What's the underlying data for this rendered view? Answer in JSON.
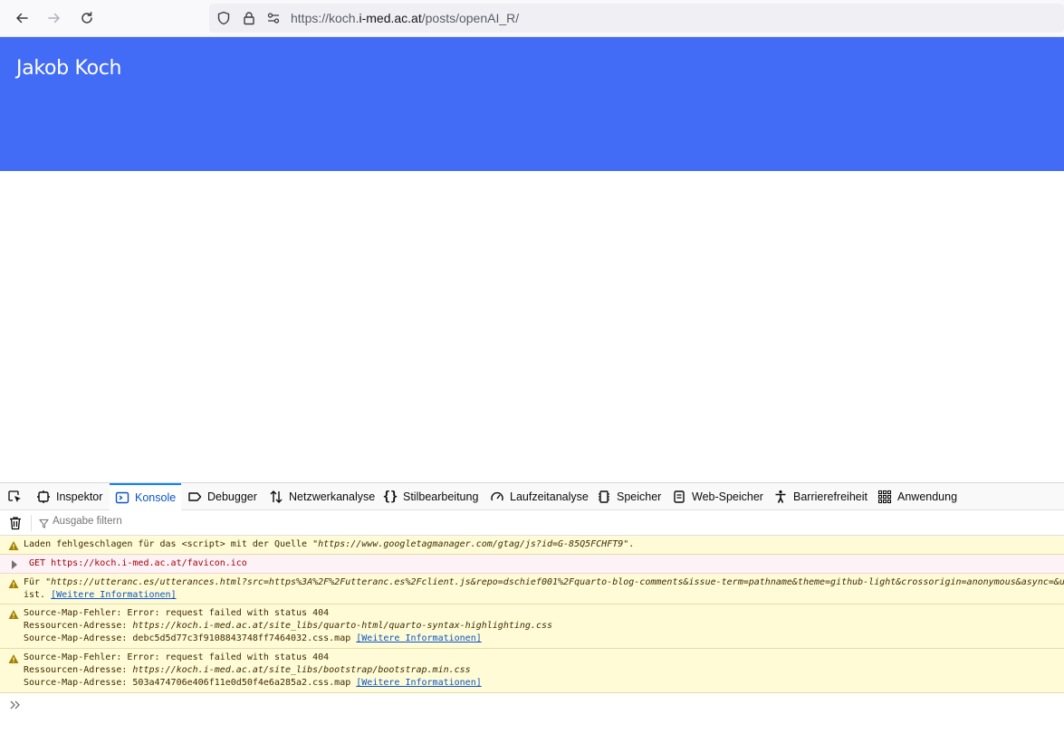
{
  "browser": {
    "url_prefix": "https://koch.",
    "url_host": "i-med.ac.at",
    "url_path": "/posts/openAI_R/"
  },
  "page": {
    "site_title": "Jakob Koch",
    "header_color": "#426cf5"
  },
  "devtools": {
    "tabs": [
      {
        "label": "Inspektor",
        "icon": "inspector-icon"
      },
      {
        "label": "Konsole",
        "icon": "console-icon",
        "active": true
      },
      {
        "label": "Debugger",
        "icon": "debugger-icon"
      },
      {
        "label": "Netzwerkanalyse",
        "icon": "network-icon"
      },
      {
        "label": "Stilbearbeitung",
        "icon": "style-editor-icon"
      },
      {
        "label": "Laufzeitanalyse",
        "icon": "performance-icon"
      },
      {
        "label": "Speicher",
        "icon": "memory-icon"
      },
      {
        "label": "Web-Speicher",
        "icon": "storage-icon"
      },
      {
        "label": "Barrierefreiheit",
        "icon": "accessibility-icon"
      },
      {
        "label": "Anwendung",
        "icon": "application-icon"
      }
    ],
    "filter_placeholder": "Ausgabe filtern",
    "messages": {
      "m1": {
        "text_a": "Laden fehlgeschlagen für das <script> mit der Quelle \"",
        "url": "https://www.googletagmanager.com/gtag/js?id=G-85Q5FCHFT9",
        "text_b": "\"."
      },
      "m2": {
        "method": "GET",
        "url": "https://koch.i-med.ac.at/favicon.ico"
      },
      "m3": {
        "text_a": "Für \"",
        "url": "https://utteranc.es/utterances.html?src=https%3A%2F%2Futteranc.es%2Fclient.js&repo=dschief001%2Fquarto-blog-comments&issue-term=pathname&theme=github-light&crossorigin=anonymous&async=&ur",
        "line2": "ist.",
        "link": "[Weitere Informationen]"
      },
      "m4": {
        "line1": "Source-Map-Fehler: Error: request failed with status 404",
        "line2_label": "Ressourcen-Adresse: ",
        "line2_url": "https://koch.i-med.ac.at/site_libs/quarto-html/quarto-syntax-highlighting.css",
        "line3": "Source-Map-Adresse: debc5d5d77c3f9108843748ff7464032.css.map",
        "link": "[Weitere Informationen]"
      },
      "m5": {
        "line1": "Source-Map-Fehler: Error: request failed with status 404",
        "line2_label": "Ressourcen-Adresse: ",
        "line2_url": "https://koch.i-med.ac.at/site_libs/bootstrap/bootstrap.min.css",
        "line3": "Source-Map-Adresse: 503a474706e406f11e0d50f4e6a285a2.css.map",
        "link": "[Weitere Informationen]"
      }
    }
  }
}
